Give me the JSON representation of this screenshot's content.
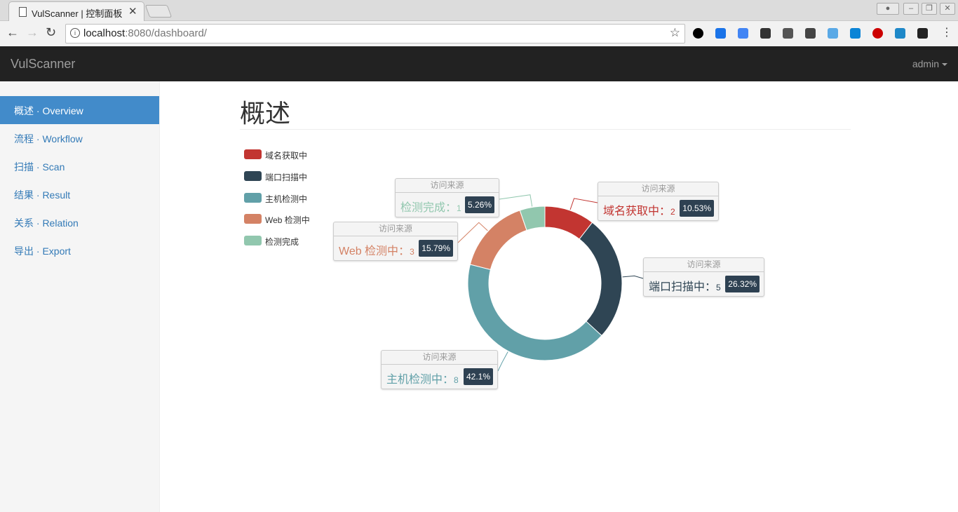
{
  "browser": {
    "tab_title": "VulScanner | 控制面板",
    "url_host": "localhost",
    "url_path": ":8080/dashboard/"
  },
  "navbar": {
    "brand": "VulScanner",
    "user": "admin"
  },
  "sidebar": {
    "items": [
      {
        "label": "概述 · Overview",
        "active": true
      },
      {
        "label": "流程 · Workflow",
        "active": false
      },
      {
        "label": "扫描 · Scan",
        "active": false
      },
      {
        "label": "结果 · Result",
        "active": false
      },
      {
        "label": "关系 · Relation",
        "active": false
      },
      {
        "label": "导出 · Export",
        "active": false
      }
    ]
  },
  "page": {
    "title": "概述"
  },
  "chart_data": {
    "type": "pie",
    "series": [
      {
        "name": "访问来源",
        "slices": [
          {
            "label": "域名获取中",
            "value": 2,
            "percent": "10.53%",
            "color": "#c23531"
          },
          {
            "label": "端口扫描中",
            "value": 5,
            "percent": "26.32%",
            "color": "#2f4554"
          },
          {
            "label": "主机检测中",
            "value": 8,
            "percent": "42.1%",
            "color": "#61a0a8"
          },
          {
            "label": "Web 检测中",
            "value": 3,
            "percent": "15.79%",
            "color": "#d48265"
          },
          {
            "label": "检测完成",
            "value": 1,
            "percent": "5.26%",
            "color": "#91c7ae"
          }
        ]
      }
    ],
    "legend_position": "top-left",
    "callout_title": "访问来源"
  }
}
